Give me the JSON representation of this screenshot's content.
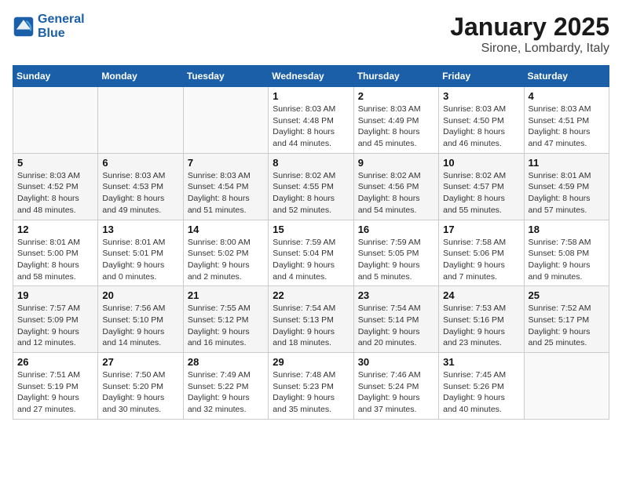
{
  "logo": {
    "line1": "General",
    "line2": "Blue"
  },
  "title": "January 2025",
  "subtitle": "Sirone, Lombardy, Italy",
  "weekdays": [
    "Sunday",
    "Monday",
    "Tuesday",
    "Wednesday",
    "Thursday",
    "Friday",
    "Saturday"
  ],
  "weeks": [
    [
      {
        "day": "",
        "info": ""
      },
      {
        "day": "",
        "info": ""
      },
      {
        "day": "",
        "info": ""
      },
      {
        "day": "1",
        "info": "Sunrise: 8:03 AM\nSunset: 4:48 PM\nDaylight: 8 hours\nand 44 minutes."
      },
      {
        "day": "2",
        "info": "Sunrise: 8:03 AM\nSunset: 4:49 PM\nDaylight: 8 hours\nand 45 minutes."
      },
      {
        "day": "3",
        "info": "Sunrise: 8:03 AM\nSunset: 4:50 PM\nDaylight: 8 hours\nand 46 minutes."
      },
      {
        "day": "4",
        "info": "Sunrise: 8:03 AM\nSunset: 4:51 PM\nDaylight: 8 hours\nand 47 minutes."
      }
    ],
    [
      {
        "day": "5",
        "info": "Sunrise: 8:03 AM\nSunset: 4:52 PM\nDaylight: 8 hours\nand 48 minutes."
      },
      {
        "day": "6",
        "info": "Sunrise: 8:03 AM\nSunset: 4:53 PM\nDaylight: 8 hours\nand 49 minutes."
      },
      {
        "day": "7",
        "info": "Sunrise: 8:03 AM\nSunset: 4:54 PM\nDaylight: 8 hours\nand 51 minutes."
      },
      {
        "day": "8",
        "info": "Sunrise: 8:02 AM\nSunset: 4:55 PM\nDaylight: 8 hours\nand 52 minutes."
      },
      {
        "day": "9",
        "info": "Sunrise: 8:02 AM\nSunset: 4:56 PM\nDaylight: 8 hours\nand 54 minutes."
      },
      {
        "day": "10",
        "info": "Sunrise: 8:02 AM\nSunset: 4:57 PM\nDaylight: 8 hours\nand 55 minutes."
      },
      {
        "day": "11",
        "info": "Sunrise: 8:01 AM\nSunset: 4:59 PM\nDaylight: 8 hours\nand 57 minutes."
      }
    ],
    [
      {
        "day": "12",
        "info": "Sunrise: 8:01 AM\nSunset: 5:00 PM\nDaylight: 8 hours\nand 58 minutes."
      },
      {
        "day": "13",
        "info": "Sunrise: 8:01 AM\nSunset: 5:01 PM\nDaylight: 9 hours\nand 0 minutes."
      },
      {
        "day": "14",
        "info": "Sunrise: 8:00 AM\nSunset: 5:02 PM\nDaylight: 9 hours\nand 2 minutes."
      },
      {
        "day": "15",
        "info": "Sunrise: 7:59 AM\nSunset: 5:04 PM\nDaylight: 9 hours\nand 4 minutes."
      },
      {
        "day": "16",
        "info": "Sunrise: 7:59 AM\nSunset: 5:05 PM\nDaylight: 9 hours\nand 5 minutes."
      },
      {
        "day": "17",
        "info": "Sunrise: 7:58 AM\nSunset: 5:06 PM\nDaylight: 9 hours\nand 7 minutes."
      },
      {
        "day": "18",
        "info": "Sunrise: 7:58 AM\nSunset: 5:08 PM\nDaylight: 9 hours\nand 9 minutes."
      }
    ],
    [
      {
        "day": "19",
        "info": "Sunrise: 7:57 AM\nSunset: 5:09 PM\nDaylight: 9 hours\nand 12 minutes."
      },
      {
        "day": "20",
        "info": "Sunrise: 7:56 AM\nSunset: 5:10 PM\nDaylight: 9 hours\nand 14 minutes."
      },
      {
        "day": "21",
        "info": "Sunrise: 7:55 AM\nSunset: 5:12 PM\nDaylight: 9 hours\nand 16 minutes."
      },
      {
        "day": "22",
        "info": "Sunrise: 7:54 AM\nSunset: 5:13 PM\nDaylight: 9 hours\nand 18 minutes."
      },
      {
        "day": "23",
        "info": "Sunrise: 7:54 AM\nSunset: 5:14 PM\nDaylight: 9 hours\nand 20 minutes."
      },
      {
        "day": "24",
        "info": "Sunrise: 7:53 AM\nSunset: 5:16 PM\nDaylight: 9 hours\nand 23 minutes."
      },
      {
        "day": "25",
        "info": "Sunrise: 7:52 AM\nSunset: 5:17 PM\nDaylight: 9 hours\nand 25 minutes."
      }
    ],
    [
      {
        "day": "26",
        "info": "Sunrise: 7:51 AM\nSunset: 5:19 PM\nDaylight: 9 hours\nand 27 minutes."
      },
      {
        "day": "27",
        "info": "Sunrise: 7:50 AM\nSunset: 5:20 PM\nDaylight: 9 hours\nand 30 minutes."
      },
      {
        "day": "28",
        "info": "Sunrise: 7:49 AM\nSunset: 5:22 PM\nDaylight: 9 hours\nand 32 minutes."
      },
      {
        "day": "29",
        "info": "Sunrise: 7:48 AM\nSunset: 5:23 PM\nDaylight: 9 hours\nand 35 minutes."
      },
      {
        "day": "30",
        "info": "Sunrise: 7:46 AM\nSunset: 5:24 PM\nDaylight: 9 hours\nand 37 minutes."
      },
      {
        "day": "31",
        "info": "Sunrise: 7:45 AM\nSunset: 5:26 PM\nDaylight: 9 hours\nand 40 minutes."
      },
      {
        "day": "",
        "info": ""
      }
    ]
  ]
}
